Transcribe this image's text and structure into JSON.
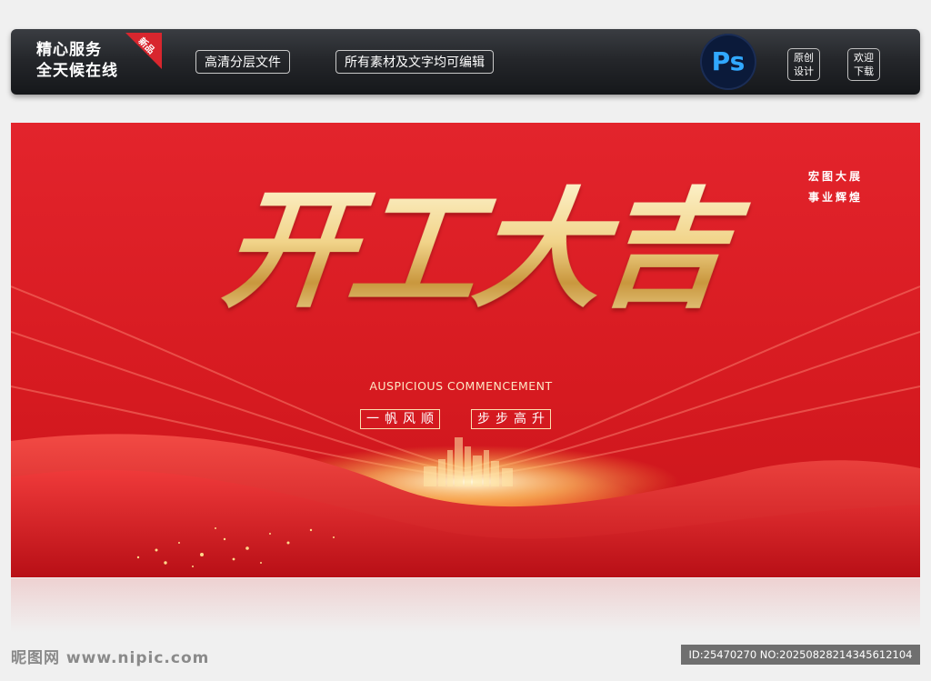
{
  "header": {
    "service_line1": "精心服务",
    "service_line2": "全天候在线",
    "new_badge": "新品",
    "tag1": "高清分层文件",
    "tag2": "所有素材及文字均可编辑",
    "ps_label": "Ps",
    "original_line1": "原创",
    "original_line2": "设计",
    "welcome_line1": "欢迎",
    "welcome_line2": "下载"
  },
  "banner": {
    "slogan_line1": "宏图大展",
    "slogan_line2": "事业辉煌",
    "title": "开工大吉",
    "subtitle_en": "AUSPICIOUS COMMENCEMENT",
    "phrase1": "一帆风顺",
    "phrase2": "步步高升"
  },
  "footer": {
    "watermark_cn": "昵图网",
    "watermark_url": "www.nipic.com",
    "image_id": "ID:25470270 NO:20250828214345612104"
  },
  "colors": {
    "banner_red": "#d61a20",
    "gold": "#f1d48a",
    "ps_blue": "#31a8ff"
  }
}
